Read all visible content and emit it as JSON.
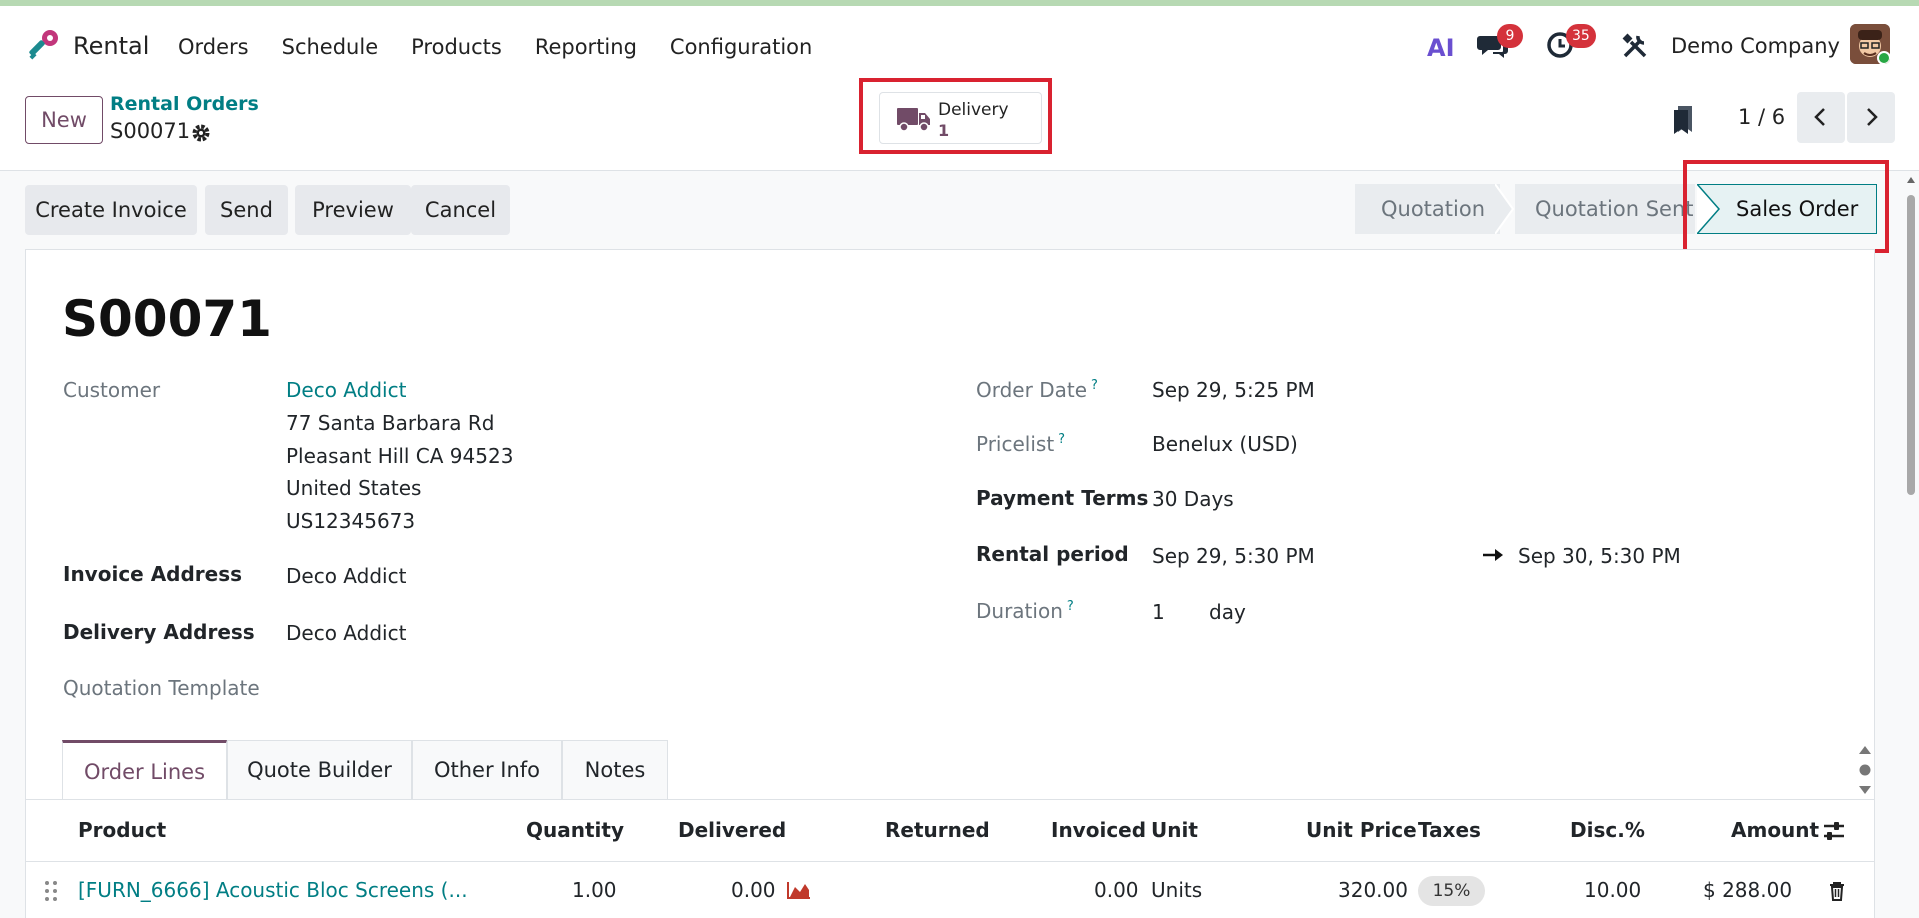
{
  "navbar": {
    "app_name": "Rental",
    "menu": [
      "Orders",
      "Schedule",
      "Products",
      "Reporting",
      "Configuration"
    ],
    "ai_label": "AI",
    "messages_count": "9",
    "activities_count": "35",
    "company": "Demo Company"
  },
  "control": {
    "new_label": "New",
    "breadcrumb_parent": "Rental Orders",
    "breadcrumb_current": "S00071",
    "smart_button": {
      "label": "Delivery",
      "value": "1"
    },
    "pager": "1 / 6"
  },
  "actions": [
    "Create Invoice",
    "Send",
    "Preview",
    "Cancel"
  ],
  "status": {
    "steps": [
      "Quotation",
      "Quotation Sent",
      "Sales Order"
    ],
    "active": "Sales Order"
  },
  "form": {
    "title": "S00071",
    "customer_label": "Customer",
    "customer_name": "Deco Addict",
    "customer_address": [
      "77 Santa Barbara Rd",
      "Pleasant Hill CA 94523",
      "United States",
      "US12345673"
    ],
    "invoice_address_label": "Invoice Address",
    "invoice_address": "Deco Addict",
    "delivery_address_label": "Delivery Address",
    "delivery_address": "Deco Addict",
    "quotation_template_label": "Quotation Template",
    "order_date_label": "Order Date",
    "order_date": "Sep 29, 5:25 PM",
    "pricelist_label": "Pricelist",
    "pricelist": "Benelux (USD)",
    "payment_terms_label": "Payment Terms",
    "payment_terms": "30 Days",
    "rental_period_label": "Rental period",
    "rental_start": "Sep 29, 5:30 PM",
    "rental_end": "Sep 30, 5:30 PM",
    "duration_label": "Duration",
    "duration_value": "1",
    "duration_unit": "day",
    "help_mark": "?"
  },
  "tabs": [
    "Order Lines",
    "Quote Builder",
    "Other Info",
    "Notes"
  ],
  "table": {
    "headers": [
      "Product",
      "Quantity",
      "Delivered",
      "Returned",
      "Invoiced",
      "Unit",
      "Unit Price",
      "Taxes",
      "Disc.%",
      "Amount"
    ],
    "rows": [
      {
        "product": "[FURN_6666] Acoustic Bloc Screens (...",
        "quantity": "1.00",
        "delivered": "0.00",
        "returned": "",
        "invoiced": "0.00",
        "unit": "Units",
        "unit_price": "320.00",
        "taxes": "15%",
        "discount": "10.00",
        "amount": "$ 288.00"
      }
    ]
  },
  "colors": {
    "primary": "#714b67",
    "link": "#017e84",
    "highlight": "#d92230",
    "badge": "#d4323b"
  }
}
